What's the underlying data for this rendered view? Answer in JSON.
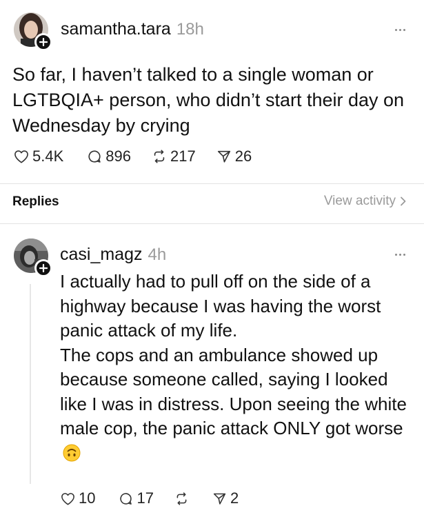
{
  "post": {
    "username": "samantha.tara",
    "time": "18h",
    "text": "So far, I haven’t talked to a single woman or LGTBQIA+ person, who didn’t start their day on Wednesday by crying",
    "stats": {
      "likes": "5.4K",
      "comments": "896",
      "reposts": "217",
      "shares": "26"
    }
  },
  "replies_bar": {
    "label": "Replies",
    "view_activity": "View activity"
  },
  "reply": {
    "username": "casi_magz",
    "time": "4h",
    "paragraph1": "I actually had to pull off on the side of a highway because I was having the worst panic attack of my life.",
    "paragraph2": "The cops and an ambulance showed up because someone called, saying I looked like I was in distress.  Upon seeing the white male cop, the panic attack ONLY got worse",
    "emoji": "upside-down-face-emoji",
    "stats": {
      "likes": "10",
      "comments": "17",
      "shares": "2"
    }
  },
  "icons": {
    "heart": "heart-icon",
    "comment": "comment-icon",
    "repost": "repost-icon",
    "share": "share-icon",
    "more": "more-icon",
    "chevron": "chevron-right-icon",
    "follow": "plus-icon"
  }
}
